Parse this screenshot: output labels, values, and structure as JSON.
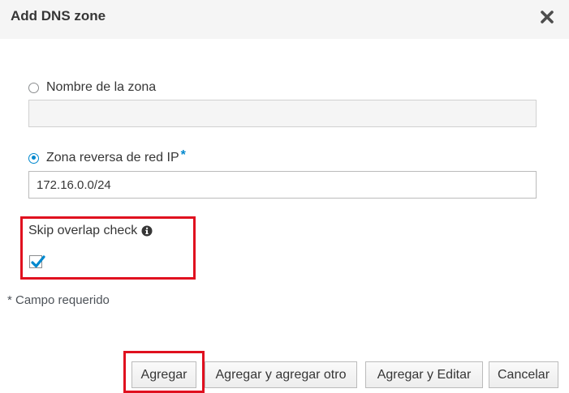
{
  "dialog": {
    "title": "Add DNS zone",
    "close_icon": "close-icon"
  },
  "form": {
    "zone_name": {
      "label": "Nombre de la zona",
      "selected": false,
      "value": ""
    },
    "reverse_zone": {
      "label": "Zona reversa de red IP",
      "required_marker": "*",
      "selected": true,
      "value": "172.16.0.0/24"
    },
    "skip_overlap": {
      "label": "Skip overlap check",
      "info_icon": "info-icon",
      "checked": true
    },
    "required_note": "* Campo requerido"
  },
  "buttons": {
    "add": "Agregar",
    "add_another": "Agregar y agregar otro",
    "add_edit": "Agregar y Editar",
    "cancel": "Cancelar"
  },
  "colors": {
    "accent": "#0088ce",
    "highlight": "#e0101f",
    "header_bg": "#f5f5f5"
  }
}
